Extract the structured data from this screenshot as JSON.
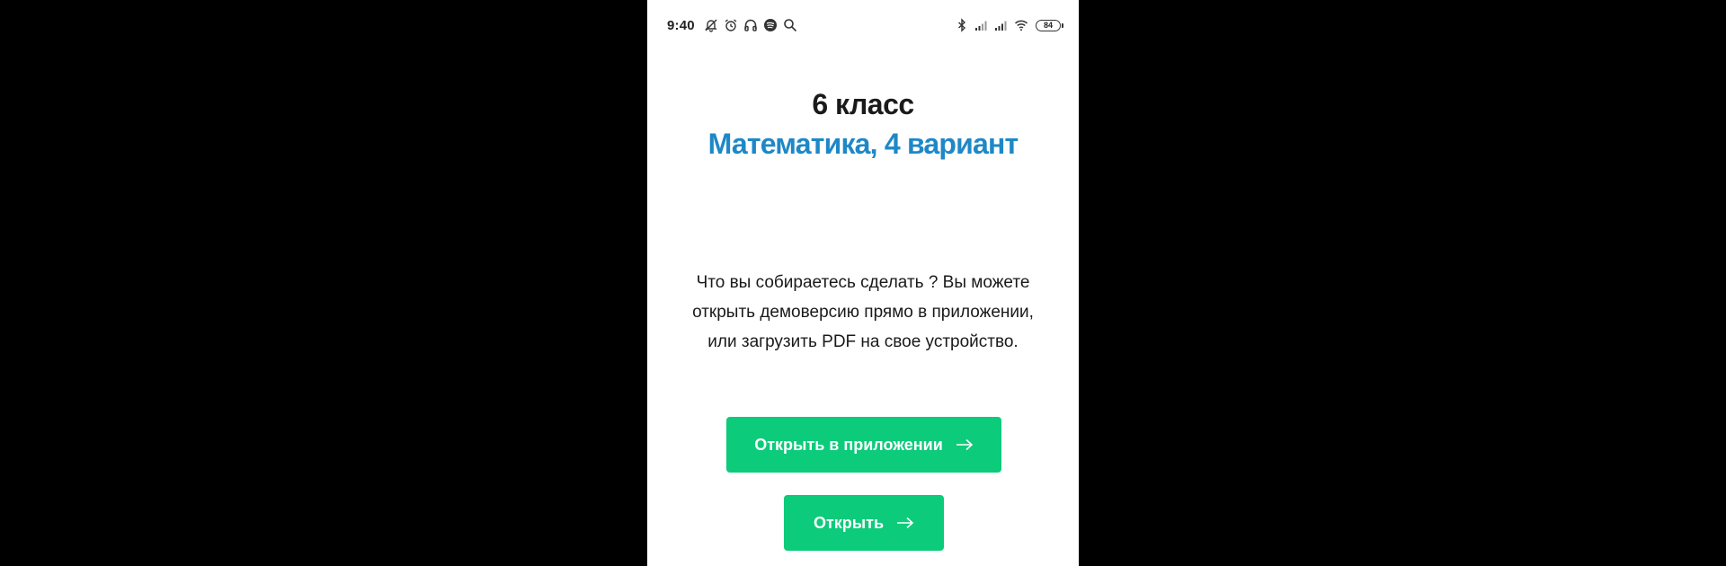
{
  "status_bar": {
    "time": "9:40",
    "battery_level": "84",
    "left_icons": [
      "notifications-off-icon",
      "alarm-icon",
      "headphones-icon",
      "spotify-icon",
      "search-icon"
    ],
    "right_icons": [
      "bluetooth-icon",
      "signal-icon",
      "signal-icon",
      "wifi-icon"
    ]
  },
  "header": {
    "grade": "6 класс",
    "subject": "Математика, 4 вариант"
  },
  "description": "Что вы собираетесь сделать ? Вы можете открыть демоверсию прямо в приложении, или загрузить PDF на свое устройство.",
  "buttons": {
    "open_in_app": "Открыть в приложении",
    "open": "Открыть"
  },
  "colors": {
    "accent_blue": "#1e88c7",
    "button_green": "#0ccb7a",
    "background": "#ffffff",
    "outer_background": "#000000"
  }
}
